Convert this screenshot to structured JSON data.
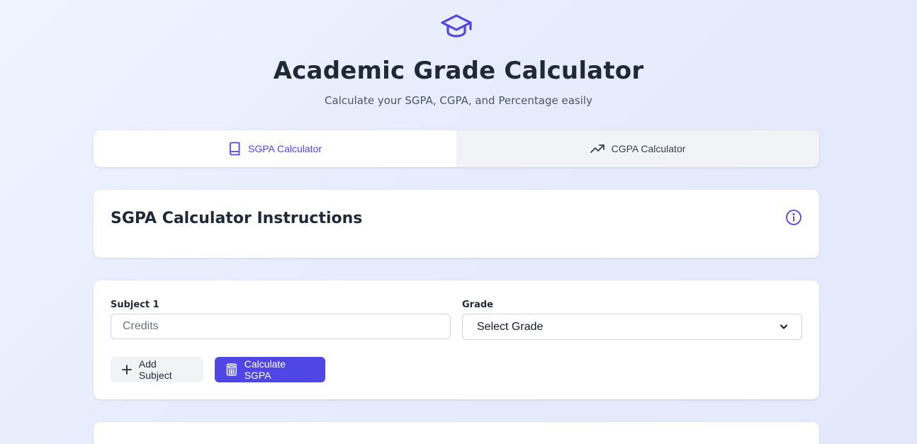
{
  "header": {
    "icon": "graduation-cap-icon",
    "title": "Academic Grade Calculator",
    "subtitle": "Calculate your SGPA, CGPA, and Percentage easily"
  },
  "tabs": [
    {
      "label": "SGPA Calculator",
      "icon": "book-icon",
      "active": true
    },
    {
      "label": "CGPA Calculator",
      "icon": "trending-up-icon",
      "active": false
    }
  ],
  "instructions": {
    "title": "SGPA Calculator Instructions",
    "icon": "info-icon"
  },
  "form": {
    "subject_label": "Subject 1",
    "credits_placeholder": "Credits",
    "credits_value": "",
    "grade_label": "Grade",
    "grade_selected": "Select Grade",
    "add_button_label": "Add Subject",
    "calc_button_label": "Calculate SGPA"
  },
  "colors": {
    "accent": "#4f46e5",
    "title": "#1f2937",
    "background": "#e6ecfb"
  }
}
